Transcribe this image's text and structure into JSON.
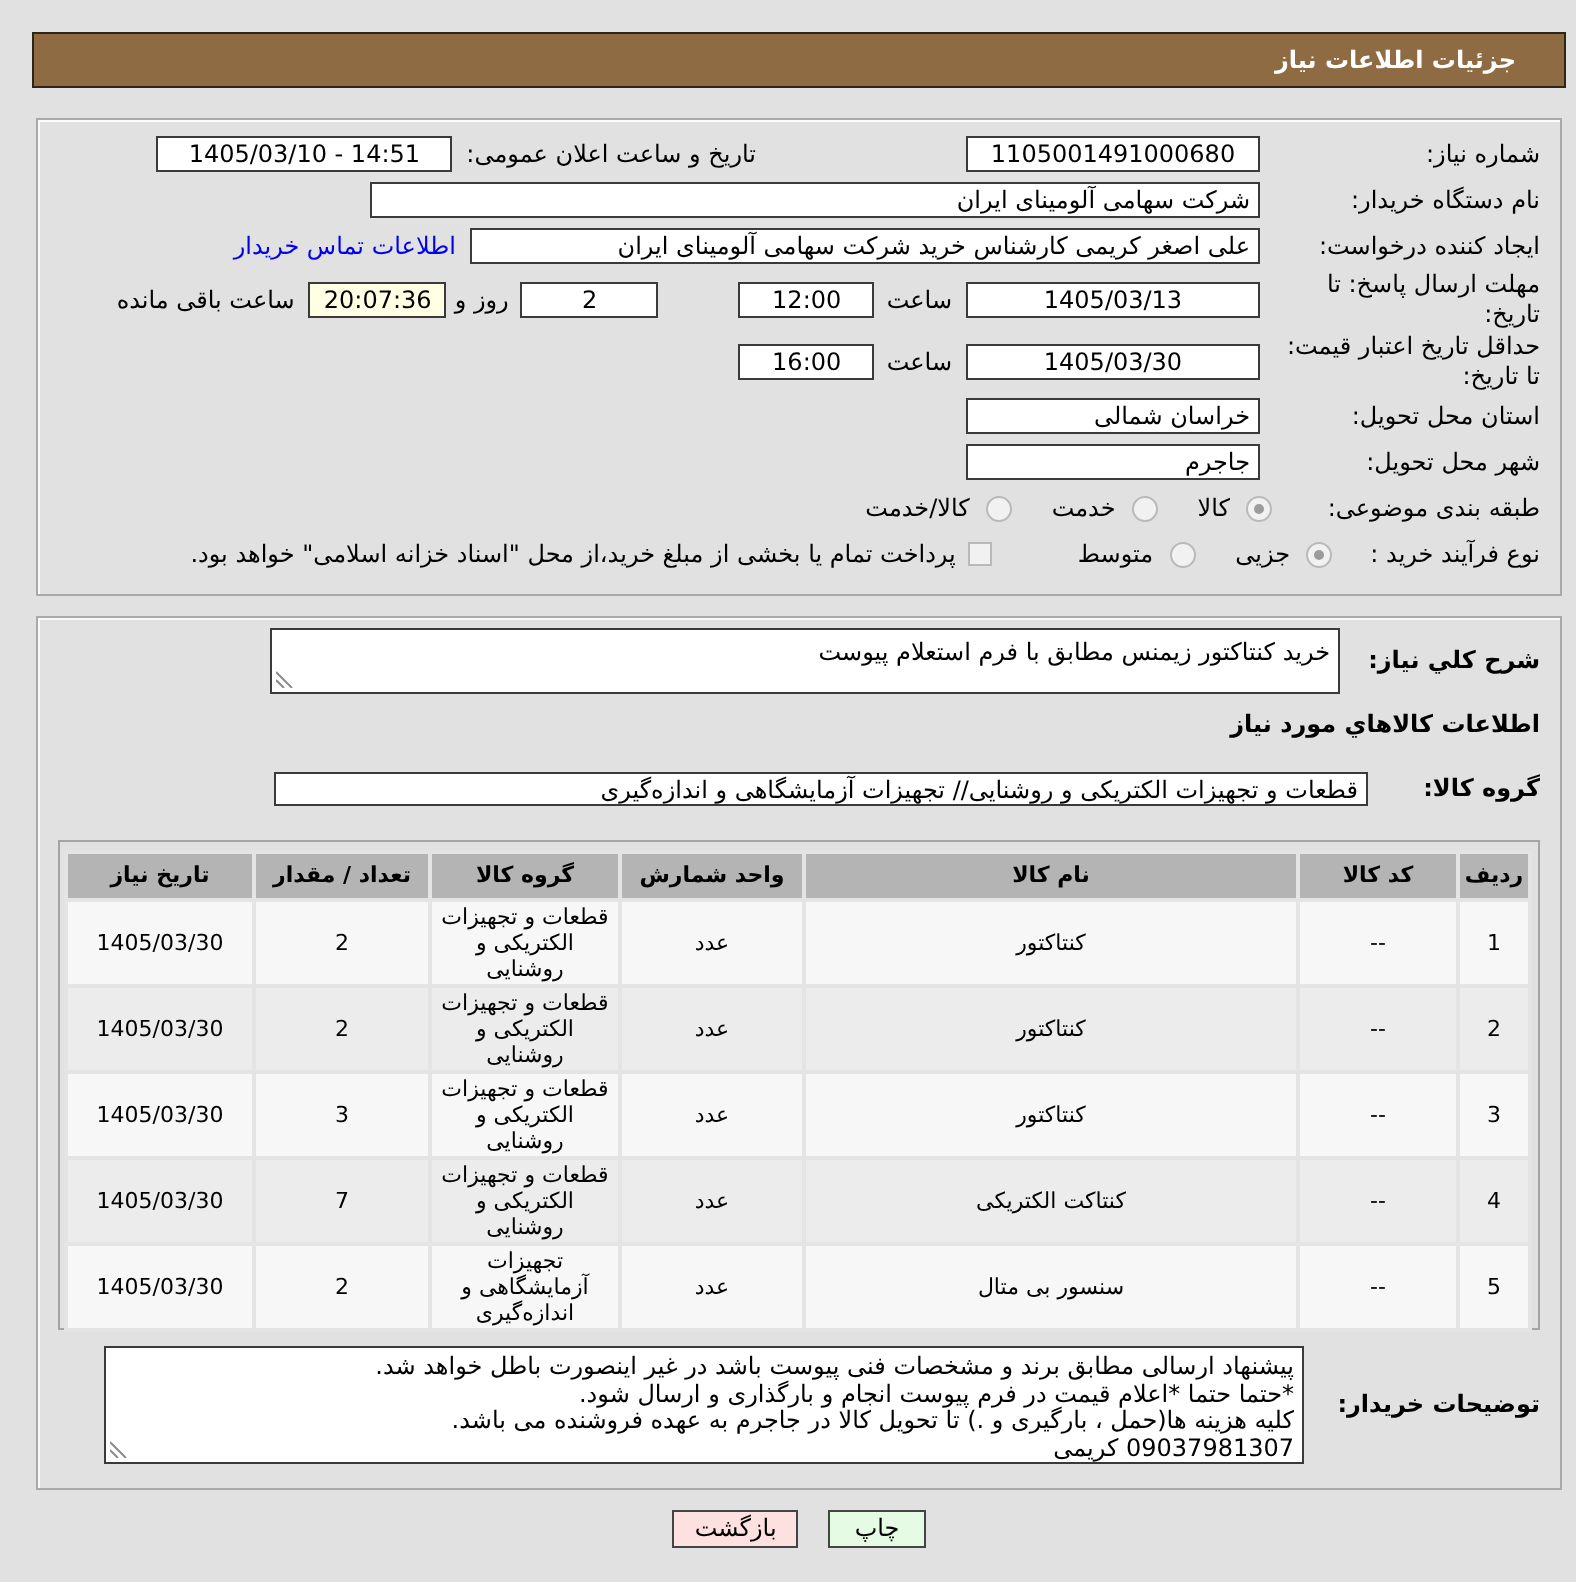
{
  "header": {
    "title": "جزئیات اطلاعات نیاز"
  },
  "details": {
    "need_number": {
      "label": "شماره نیاز:",
      "value": "1105001491000680"
    },
    "announcement": {
      "label": "تاریخ و ساعت اعلان عمومی:",
      "value": "1405/03/10 - 14:51"
    },
    "buyer": {
      "label": "نام دستگاه خریدار:",
      "value": "شرکت سهامی آلومینای ایران"
    },
    "requester": {
      "label": "ایجاد کننده درخواست:",
      "value": "علی اصغر کریمی کارشناس خرید شرکت سهامی آلومینای ایران",
      "contact_link": "اطلاعات تماس خریدار"
    },
    "reply_deadline": {
      "label": "مهلت ارسال پاسخ: تا تاریخ:",
      "date": "1405/03/13",
      "time_label": "ساعت",
      "time": "12:00",
      "days": "2",
      "days_label": "روز و",
      "remaining": "20:07:36",
      "remaining_label": "ساعت باقی مانده"
    },
    "price_validity": {
      "label": "حداقل تاریخ اعتبار قیمت: تا تاریخ:",
      "date": "1405/03/30",
      "time_label": "ساعت",
      "time": "16:00"
    },
    "province": {
      "label": "استان محل تحویل:",
      "value": "خراسان شمالی"
    },
    "city": {
      "label": "شهر محل تحویل:",
      "value": "جاجرم"
    },
    "category": {
      "label": "طبقه بندی موضوعی:",
      "options": [
        {
          "label": "کالا",
          "selected": true
        },
        {
          "label": "خدمت",
          "selected": false
        },
        {
          "label": "کالا/خدمت",
          "selected": false
        }
      ]
    },
    "purchase_type": {
      "label": "نوع فرآیند خرید :",
      "options": [
        {
          "label": "جزیی",
          "selected": true
        },
        {
          "label": "متوسط",
          "selected": false
        }
      ],
      "treasury_payment": {
        "label": "پرداخت تمام یا بخشی از مبلغ خرید،از محل \"اسناد خزانه اسلامی\" خواهد بود.",
        "checked": false
      }
    }
  },
  "description": {
    "label": "شرح کلي نياز:",
    "value": "خرید کنتاکتور زیمنس مطابق با فرم استعلام پیوست"
  },
  "goods": {
    "title": "اطلاعات کالاهاي مورد نياز",
    "group": {
      "label": "گروه کالا:",
      "value": "قطعات و تجهیزات الکتریکی و روشنایی// تجهیزات آزمایشگاهی و اندازه‌گیری"
    },
    "table": {
      "columns": [
        "ردیف",
        "کد کالا",
        "نام کالا",
        "واحد شمارش",
        "گروه کالا",
        "تعداد / مقدار",
        "تاریخ نیاز"
      ],
      "rows": [
        [
          "1",
          "--",
          "کنتاکتور",
          "عدد",
          "قطعات و تجهیزات الکتریکی و روشنایی",
          "2",
          "1405/03/30"
        ],
        [
          "2",
          "--",
          "کنتاکتور",
          "عدد",
          "قطعات و تجهیزات الکتریکی و روشنایی",
          "2",
          "1405/03/30"
        ],
        [
          "3",
          "--",
          "کنتاکتور",
          "عدد",
          "قطعات و تجهیزات الکتریکی و روشنایی",
          "3",
          "1405/03/30"
        ],
        [
          "4",
          "--",
          "کنتاکت الکتریکی",
          "عدد",
          "قطعات و تجهیزات الکتریکی و روشنایی",
          "7",
          "1405/03/30"
        ],
        [
          "5",
          "--",
          "سنسور بی متال",
          "عدد",
          "تجهیزات آزمایشگاهی و اندازه‌گیری",
          "2",
          "1405/03/30"
        ]
      ]
    }
  },
  "buyer_notes": {
    "label": "توضیحات خریدار:",
    "lines": [
      "پیشنهاد ارسالی مطابق برند و مشخصات فنی پیوست باشد در غیر اینصورت باطل خواهد شد.",
      "*حتما حتما *اعلام قیمت در فرم پیوست انجام و بارگذاری و ارسال شود.",
      "کلیه هزینه ها(حمل ، بارگیری و .) تا تحویل کالا در جاجرم به عهده فروشنده می باشد.",
      "09037981307 کریمی"
    ]
  },
  "buttons": [
    {
      "label": "چاپ",
      "kind": "print"
    },
    {
      "label": "بازگشت",
      "kind": "back"
    }
  ]
}
